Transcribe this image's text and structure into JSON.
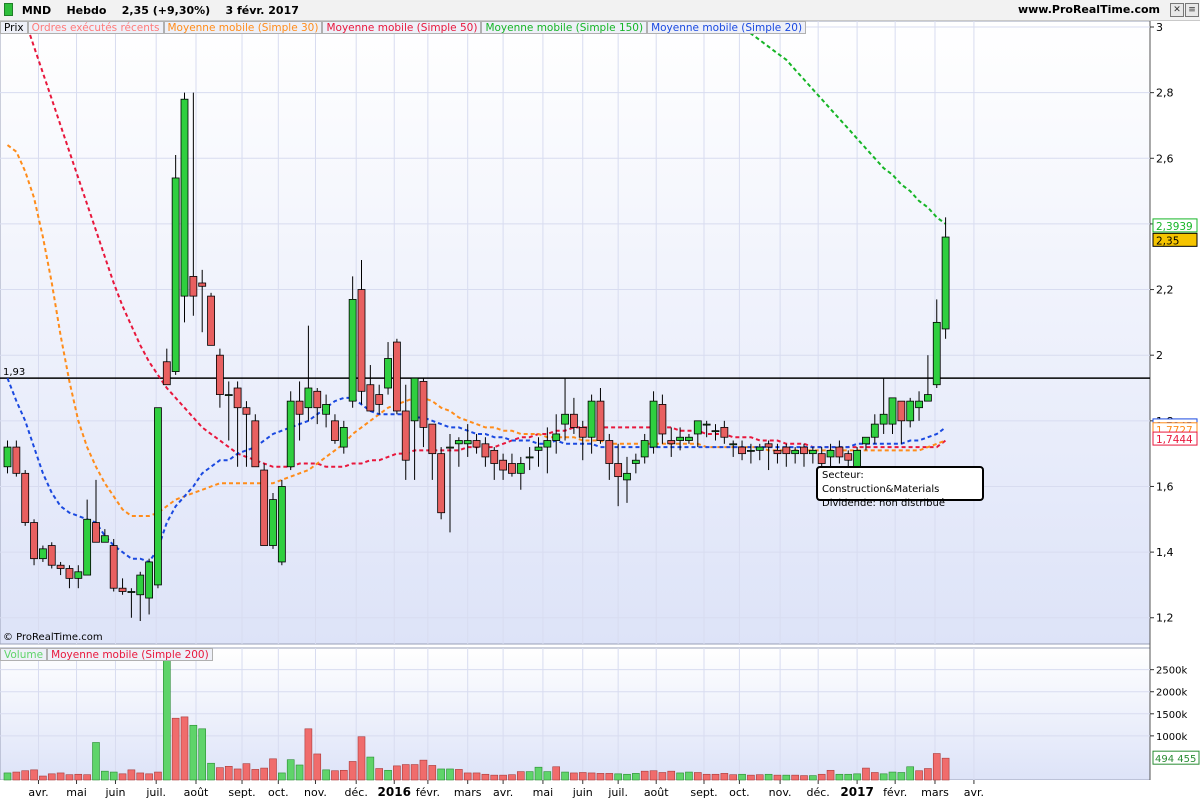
{
  "header": {
    "symbol": "MND",
    "period": "Hebdo",
    "last": "2,35 (+9,30%)",
    "date": "3 févr. 2017",
    "site": "www.ProRealTime.com"
  },
  "price_legend": [
    {
      "label": "Prix",
      "color": "#000000"
    },
    {
      "label": "Ordres exécutés récents",
      "color": "#ff7a7a"
    },
    {
      "label": "Moyenne mobile (Simple 30)",
      "color": "#ff8c1a"
    },
    {
      "label": "Moyenne mobile (Simple 50)",
      "color": "#e8173c"
    },
    {
      "label": "Moyenne mobile (Simple 150)",
      "color": "#16b526"
    },
    {
      "label": "Moyenne mobile (Simple 20)",
      "color": "#1a49e0"
    }
  ],
  "volume_legend": [
    {
      "label": "Volume",
      "color": "#5fd46a"
    },
    {
      "label": "Moyenne mobile (Simple 200)",
      "color": "#e8173c"
    }
  ],
  "info_box": {
    "line1": "Secteur: Construction&Materials",
    "line2": "Dividende: non distribué"
  },
  "copyright": "© ProRealTime.com",
  "colors": {
    "up": "#2fcf3f",
    "down": "#e86060",
    "ma20": "#1a49e0",
    "ma30": "#ff8c1a",
    "ma50": "#e8173c",
    "ma150": "#16b526",
    "grid": "#d8dcf0",
    "panel_top": "#ffffff",
    "panel_bottom": "#dde3f8"
  },
  "chart_data": {
    "type": "candlestick",
    "price_axis": {
      "min": 1.12,
      "max": 3.0,
      "ticks": [
        "1,2",
        "1,4",
        "1,6",
        "1,8",
        "2",
        "2,2",
        "2,4",
        "2,6",
        "2,8",
        "3"
      ]
    },
    "volume_axis": {
      "min": 0,
      "max": 2900000,
      "ticks": [
        "1000k",
        "1500k",
        "2000k",
        "2500k"
      ]
    },
    "x_labels": [
      {
        "i": 3.5,
        "text": "avr."
      },
      {
        "i": 7.8,
        "text": "mai"
      },
      {
        "i": 12.2,
        "text": "juin"
      },
      {
        "i": 16.8,
        "text": "juil."
      },
      {
        "i": 21.3,
        "text": "août"
      },
      {
        "i": 26.5,
        "text": "sept."
      },
      {
        "i": 30.6,
        "text": "oct."
      },
      {
        "i": 34.8,
        "text": "nov."
      },
      {
        "i": 39.4,
        "text": "déc."
      },
      {
        "i": 43.7,
        "text": "2016",
        "bold": true
      },
      {
        "i": 47.5,
        "text": "févr."
      },
      {
        "i": 52.0,
        "text": "mars"
      },
      {
        "i": 56.0,
        "text": "avr."
      },
      {
        "i": 60.5,
        "text": "mai"
      },
      {
        "i": 65.0,
        "text": "juin"
      },
      {
        "i": 69.0,
        "text": "juil."
      },
      {
        "i": 73.3,
        "text": "août"
      },
      {
        "i": 78.7,
        "text": "sept."
      },
      {
        "i": 82.7,
        "text": "oct."
      },
      {
        "i": 87.3,
        "text": "nov."
      },
      {
        "i": 91.6,
        "text": "déc."
      },
      {
        "i": 96.0,
        "text": "2017",
        "bold": true
      },
      {
        "i": 100.3,
        "text": "févr."
      },
      {
        "i": 104.8,
        "text": "mars"
      },
      {
        "i": 109.2,
        "text": "avr."
      }
    ],
    "horizontal_line": {
      "value": 1.93,
      "label": "1,93"
    },
    "last_labels": [
      {
        "value": 2.3939,
        "text": "2,3939",
        "color": "#16b526",
        "bg": "#ffffff"
      },
      {
        "value": 2.35,
        "text": "2,35",
        "color": "#000000",
        "bg": "#f5c400"
      },
      {
        "value": 1.7845,
        "text": "1,7845",
        "color": "#1a49e0",
        "bg": "#ffffff"
      },
      {
        "value": 1.7727,
        "text": "1,7727",
        "color": "#ff8c1a",
        "bg": "#ffffff"
      },
      {
        "value": 1.7444,
        "text": "1,7444",
        "color": "#e8173c",
        "bg": "#ffffff"
      }
    ],
    "volume_last_label": {
      "value": 494455,
      "text": "494 455"
    },
    "candles": [
      [
        1.66,
        1.74,
        1.64,
        1.72
      ],
      [
        1.72,
        1.74,
        1.63,
        1.64
      ],
      [
        1.64,
        1.65,
        1.48,
        1.49
      ],
      [
        1.49,
        1.5,
        1.36,
        1.38
      ],
      [
        1.38,
        1.42,
        1.37,
        1.41
      ],
      [
        1.42,
        1.43,
        1.35,
        1.36
      ],
      [
        1.36,
        1.37,
        1.33,
        1.35
      ],
      [
        1.35,
        1.36,
        1.29,
        1.32
      ],
      [
        1.32,
        1.36,
        1.29,
        1.34
      ],
      [
        1.33,
        1.56,
        1.33,
        1.5
      ],
      [
        1.49,
        1.62,
        1.43,
        1.43
      ],
      [
        1.43,
        1.47,
        1.43,
        1.45
      ],
      [
        1.42,
        1.44,
        1.28,
        1.29
      ],
      [
        1.29,
        1.32,
        1.27,
        1.28
      ],
      [
        1.28,
        1.29,
        1.2,
        1.28
      ],
      [
        1.27,
        1.34,
        1.19,
        1.33
      ],
      [
        1.26,
        1.38,
        1.21,
        1.37
      ],
      [
        1.3,
        1.84,
        1.29,
        1.84
      ],
      [
        1.98,
        2.02,
        1.92,
        1.91
      ],
      [
        1.95,
        2.61,
        1.94,
        2.54
      ],
      [
        2.18,
        2.8,
        2.1,
        2.78
      ],
      [
        2.24,
        2.8,
        2.12,
        2.18
      ],
      [
        2.22,
        2.26,
        2.07,
        2.21
      ],
      [
        2.18,
        2.19,
        2.03,
        2.03
      ],
      [
        2.0,
        2.02,
        1.84,
        1.88
      ],
      [
        1.88,
        1.92,
        1.74,
        1.88
      ],
      [
        1.9,
        1.92,
        1.66,
        1.84
      ],
      [
        1.84,
        1.86,
        1.66,
        1.82
      ],
      [
        1.8,
        1.82,
        1.72,
        1.66
      ],
      [
        1.65,
        1.67,
        1.46,
        1.42
      ],
      [
        1.42,
        1.58,
        1.41,
        1.56
      ],
      [
        1.37,
        1.62,
        1.36,
        1.6
      ],
      [
        1.66,
        1.89,
        1.65,
        1.86
      ],
      [
        1.86,
        1.92,
        1.74,
        1.82
      ],
      [
        1.84,
        2.09,
        1.8,
        1.9
      ],
      [
        1.89,
        1.9,
        1.79,
        1.84
      ],
      [
        1.82,
        1.88,
        1.78,
        1.85
      ],
      [
        1.8,
        1.82,
        1.73,
        1.74
      ],
      [
        1.72,
        1.8,
        1.7,
        1.78
      ],
      [
        1.86,
        2.24,
        1.84,
        2.17
      ],
      [
        2.2,
        2.29,
        1.85,
        1.89
      ],
      [
        1.91,
        1.97,
        1.84,
        1.83
      ],
      [
        1.88,
        1.91,
        1.82,
        1.85
      ],
      [
        1.9,
        2.04,
        1.88,
        1.99
      ],
      [
        2.04,
        2.05,
        1.82,
        1.83
      ],
      [
        1.83,
        1.91,
        1.62,
        1.68
      ],
      [
        1.8,
        1.92,
        1.62,
        1.93
      ],
      [
        1.92,
        1.93,
        1.72,
        1.78
      ],
      [
        1.79,
        1.79,
        1.62,
        1.7
      ],
      [
        1.7,
        1.72,
        1.5,
        1.52
      ],
      [
        1.72,
        1.76,
        1.46,
        1.72
      ],
      [
        1.73,
        1.75,
        1.66,
        1.74
      ],
      [
        1.73,
        1.79,
        1.69,
        1.74
      ],
      [
        1.74,
        1.76,
        1.7,
        1.72
      ],
      [
        1.73,
        1.75,
        1.66,
        1.69
      ],
      [
        1.71,
        1.72,
        1.62,
        1.67
      ],
      [
        1.68,
        1.7,
        1.62,
        1.65
      ],
      [
        1.67,
        1.7,
        1.63,
        1.64
      ],
      [
        1.64,
        1.69,
        1.59,
        1.67
      ],
      [
        1.69,
        1.72,
        1.65,
        1.69
      ],
      [
        1.71,
        1.75,
        1.66,
        1.72
      ],
      [
        1.72,
        1.78,
        1.64,
        1.74
      ],
      [
        1.74,
        1.82,
        1.7,
        1.76
      ],
      [
        1.79,
        1.93,
        1.74,
        1.82
      ],
      [
        1.82,
        1.87,
        1.76,
        1.78
      ],
      [
        1.78,
        1.8,
        1.68,
        1.75
      ],
      [
        1.75,
        1.88,
        1.7,
        1.86
      ],
      [
        1.86,
        1.9,
        1.73,
        1.74
      ],
      [
        1.74,
        1.76,
        1.62,
        1.67
      ],
      [
        1.67,
        1.73,
        1.54,
        1.63
      ],
      [
        1.62,
        1.69,
        1.55,
        1.64
      ],
      [
        1.67,
        1.7,
        1.64,
        1.68
      ],
      [
        1.69,
        1.76,
        1.67,
        1.74
      ],
      [
        1.72,
        1.89,
        1.7,
        1.86
      ],
      [
        1.85,
        1.88,
        1.73,
        1.76
      ],
      [
        1.74,
        1.78,
        1.69,
        1.73
      ],
      [
        1.74,
        1.78,
        1.71,
        1.75
      ],
      [
        1.74,
        1.76,
        1.73,
        1.75
      ],
      [
        1.76,
        1.8,
        1.72,
        1.8
      ],
      [
        1.79,
        1.8,
        1.75,
        1.79
      ],
      [
        1.77,
        1.79,
        1.74,
        1.77
      ],
      [
        1.78,
        1.8,
        1.73,
        1.75
      ],
      [
        1.73,
        1.74,
        1.69,
        1.73
      ],
      [
        1.72,
        1.74,
        1.68,
        1.7
      ],
      [
        1.71,
        1.73,
        1.67,
        1.71
      ],
      [
        1.71,
        1.73,
        1.68,
        1.72
      ],
      [
        1.73,
        1.74,
        1.65,
        1.72
      ],
      [
        1.71,
        1.73,
        1.67,
        1.7
      ],
      [
        1.72,
        1.73,
        1.66,
        1.7
      ],
      [
        1.7,
        1.72,
        1.67,
        1.71
      ],
      [
        1.72,
        1.73,
        1.66,
        1.7
      ],
      [
        1.7,
        1.72,
        1.67,
        1.71
      ],
      [
        1.7,
        1.72,
        1.6,
        1.67
      ],
      [
        1.69,
        1.73,
        1.65,
        1.71
      ],
      [
        1.72,
        1.74,
        1.67,
        1.69
      ],
      [
        1.7,
        1.71,
        1.66,
        1.68
      ],
      [
        1.66,
        1.72,
        1.64,
        1.71
      ],
      [
        1.73,
        1.75,
        1.71,
        1.75
      ],
      [
        1.75,
        1.82,
        1.73,
        1.79
      ],
      [
        1.79,
        1.93,
        1.76,
        1.82
      ],
      [
        1.79,
        1.85,
        1.76,
        1.87
      ],
      [
        1.86,
        1.86,
        1.73,
        1.8
      ],
      [
        1.8,
        1.87,
        1.78,
        1.86
      ],
      [
        1.84,
        1.89,
        1.8,
        1.86
      ],
      [
        1.86,
        2.0,
        1.86,
        1.88
      ],
      [
        1.91,
        2.17,
        1.9,
        2.1
      ],
      [
        2.08,
        2.42,
        2.05,
        2.36
      ]
    ],
    "ma20": [
      1.93,
      1.86,
      1.8,
      1.72,
      1.64,
      1.58,
      1.54,
      1.52,
      1.51,
      1.5,
      1.49,
      1.45,
      1.42,
      1.4,
      1.38,
      1.38,
      1.37,
      1.41,
      1.49,
      1.54,
      1.57,
      1.6,
      1.64,
      1.66,
      1.68,
      1.68,
      1.7,
      1.71,
      1.72,
      1.74,
      1.76,
      1.77,
      1.78,
      1.79,
      1.8,
      1.82,
      1.84,
      1.86,
      1.87,
      1.87,
      1.85,
      1.83,
      1.82,
      1.82,
      1.82,
      1.82,
      1.81,
      1.81,
      1.8,
      1.79,
      1.78,
      1.78,
      1.77,
      1.76,
      1.76,
      1.75,
      1.75,
      1.74,
      1.74,
      1.74,
      1.73,
      1.73,
      1.74,
      1.73,
      1.73,
      1.73,
      1.73,
      1.72,
      1.72,
      1.72,
      1.72,
      1.72,
      1.72,
      1.72,
      1.72,
      1.72,
      1.72,
      1.72,
      1.72,
      1.72,
      1.72,
      1.72,
      1.72,
      1.72,
      1.72,
      1.72,
      1.72,
      1.72,
      1.72,
      1.72,
      1.72,
      1.72,
      1.72,
      1.72,
      1.72,
      1.72,
      1.73,
      1.73,
      1.73,
      1.73,
      1.73,
      1.73,
      1.74,
      1.74,
      1.75,
      1.76,
      1.78
    ],
    "ma30": [
      2.64,
      2.62,
      2.56,
      2.48,
      2.36,
      2.22,
      2.06,
      1.92,
      1.8,
      1.72,
      1.66,
      1.61,
      1.57,
      1.53,
      1.51,
      1.51,
      1.51,
      1.52,
      1.54,
      1.56,
      1.57,
      1.58,
      1.59,
      1.6,
      1.61,
      1.61,
      1.61,
      1.61,
      1.61,
      1.61,
      1.61,
      1.62,
      1.63,
      1.64,
      1.65,
      1.67,
      1.69,
      1.71,
      1.73,
      1.76,
      1.78,
      1.8,
      1.82,
      1.84,
      1.85,
      1.86,
      1.87,
      1.87,
      1.86,
      1.84,
      1.83,
      1.81,
      1.8,
      1.79,
      1.78,
      1.78,
      1.77,
      1.77,
      1.76,
      1.76,
      1.76,
      1.75,
      1.75,
      1.75,
      1.75,
      1.74,
      1.74,
      1.74,
      1.73,
      1.73,
      1.73,
      1.73,
      1.73,
      1.73,
      1.73,
      1.73,
      1.73,
      1.73,
      1.73,
      1.72,
      1.72,
      1.72,
      1.72,
      1.72,
      1.72,
      1.72,
      1.71,
      1.71,
      1.71,
      1.71,
      1.71,
      1.71,
      1.71,
      1.71,
      1.71,
      1.71,
      1.71,
      1.71,
      1.71,
      1.71,
      1.71,
      1.71,
      1.71,
      1.71,
      1.72,
      1.73,
      1.74
    ],
    "ma50": [
      3.2,
      3.12,
      3.02,
      2.94,
      2.86,
      2.78,
      2.7,
      2.62,
      2.54,
      2.46,
      2.38,
      2.3,
      2.22,
      2.15,
      2.09,
      2.03,
      1.98,
      1.94,
      1.9,
      1.87,
      1.84,
      1.81,
      1.78,
      1.76,
      1.74,
      1.72,
      1.7,
      1.69,
      1.68,
      1.67,
      1.66,
      1.66,
      1.66,
      1.67,
      1.67,
      1.67,
      1.66,
      1.66,
      1.66,
      1.67,
      1.67,
      1.68,
      1.68,
      1.69,
      1.7,
      1.7,
      1.71,
      1.71,
      1.71,
      1.71,
      1.71,
      1.71,
      1.72,
      1.72,
      1.72,
      1.72,
      1.73,
      1.74,
      1.75,
      1.75,
      1.76,
      1.76,
      1.77,
      1.77,
      1.78,
      1.78,
      1.78,
      1.78,
      1.78,
      1.78,
      1.78,
      1.78,
      1.78,
      1.78,
      1.78,
      1.78,
      1.77,
      1.77,
      1.77,
      1.76,
      1.76,
      1.76,
      1.75,
      1.75,
      1.75,
      1.74,
      1.74,
      1.74,
      1.73,
      1.73,
      1.73,
      1.72,
      1.72,
      1.72,
      1.72,
      1.72,
      1.72,
      1.72,
      1.72,
      1.72,
      1.72,
      1.72,
      1.72,
      1.72,
      1.72,
      1.72,
      1.74
    ],
    "ma150": {
      "start_index": 82,
      "values": [
        3.02,
        3.0,
        2.98,
        2.96,
        2.94,
        2.92,
        2.9,
        2.87,
        2.84,
        2.81,
        2.78,
        2.75,
        2.72,
        2.69,
        2.66,
        2.63,
        2.6,
        2.57,
        2.55,
        2.52,
        2.5,
        2.47,
        2.45,
        2.42,
        2.4
      ]
    },
    "volume": [
      160000,
      180000,
      210000,
      230000,
      90000,
      140000,
      160000,
      120000,
      130000,
      120000,
      850000,
      200000,
      180000,
      140000,
      230000,
      160000,
      140000,
      180000,
      2880000,
      1400000,
      1430000,
      1240000,
      1160000,
      380000,
      280000,
      310000,
      250000,
      370000,
      240000,
      270000,
      480000,
      160000,
      460000,
      340000,
      1160000,
      590000,
      230000,
      210000,
      220000,
      420000,
      980000,
      520000,
      260000,
      220000,
      320000,
      350000,
      350000,
      450000,
      330000,
      250000,
      250000,
      240000,
      160000,
      160000,
      130000,
      110000,
      110000,
      120000,
      190000,
      190000,
      290000,
      190000,
      300000,
      180000,
      160000,
      170000,
      160000,
      150000,
      150000,
      140000,
      130000,
      150000,
      200000,
      210000,
      170000,
      200000,
      160000,
      180000,
      170000,
      130000,
      130000,
      150000,
      120000,
      130000,
      110000,
      120000,
      130000,
      110000,
      110000,
      110000,
      100000,
      100000,
      130000,
      220000,
      130000,
      130000,
      140000,
      270000,
      170000,
      140000,
      180000,
      170000,
      300000,
      210000,
      260000,
      600000,
      494455
    ],
    "volume_directions": "uddddddddduuudddddudduuuddddddduuudduddddududdddduudddddddduuududdddduuudddduuddddduddududdudduuudduuuu"
  }
}
